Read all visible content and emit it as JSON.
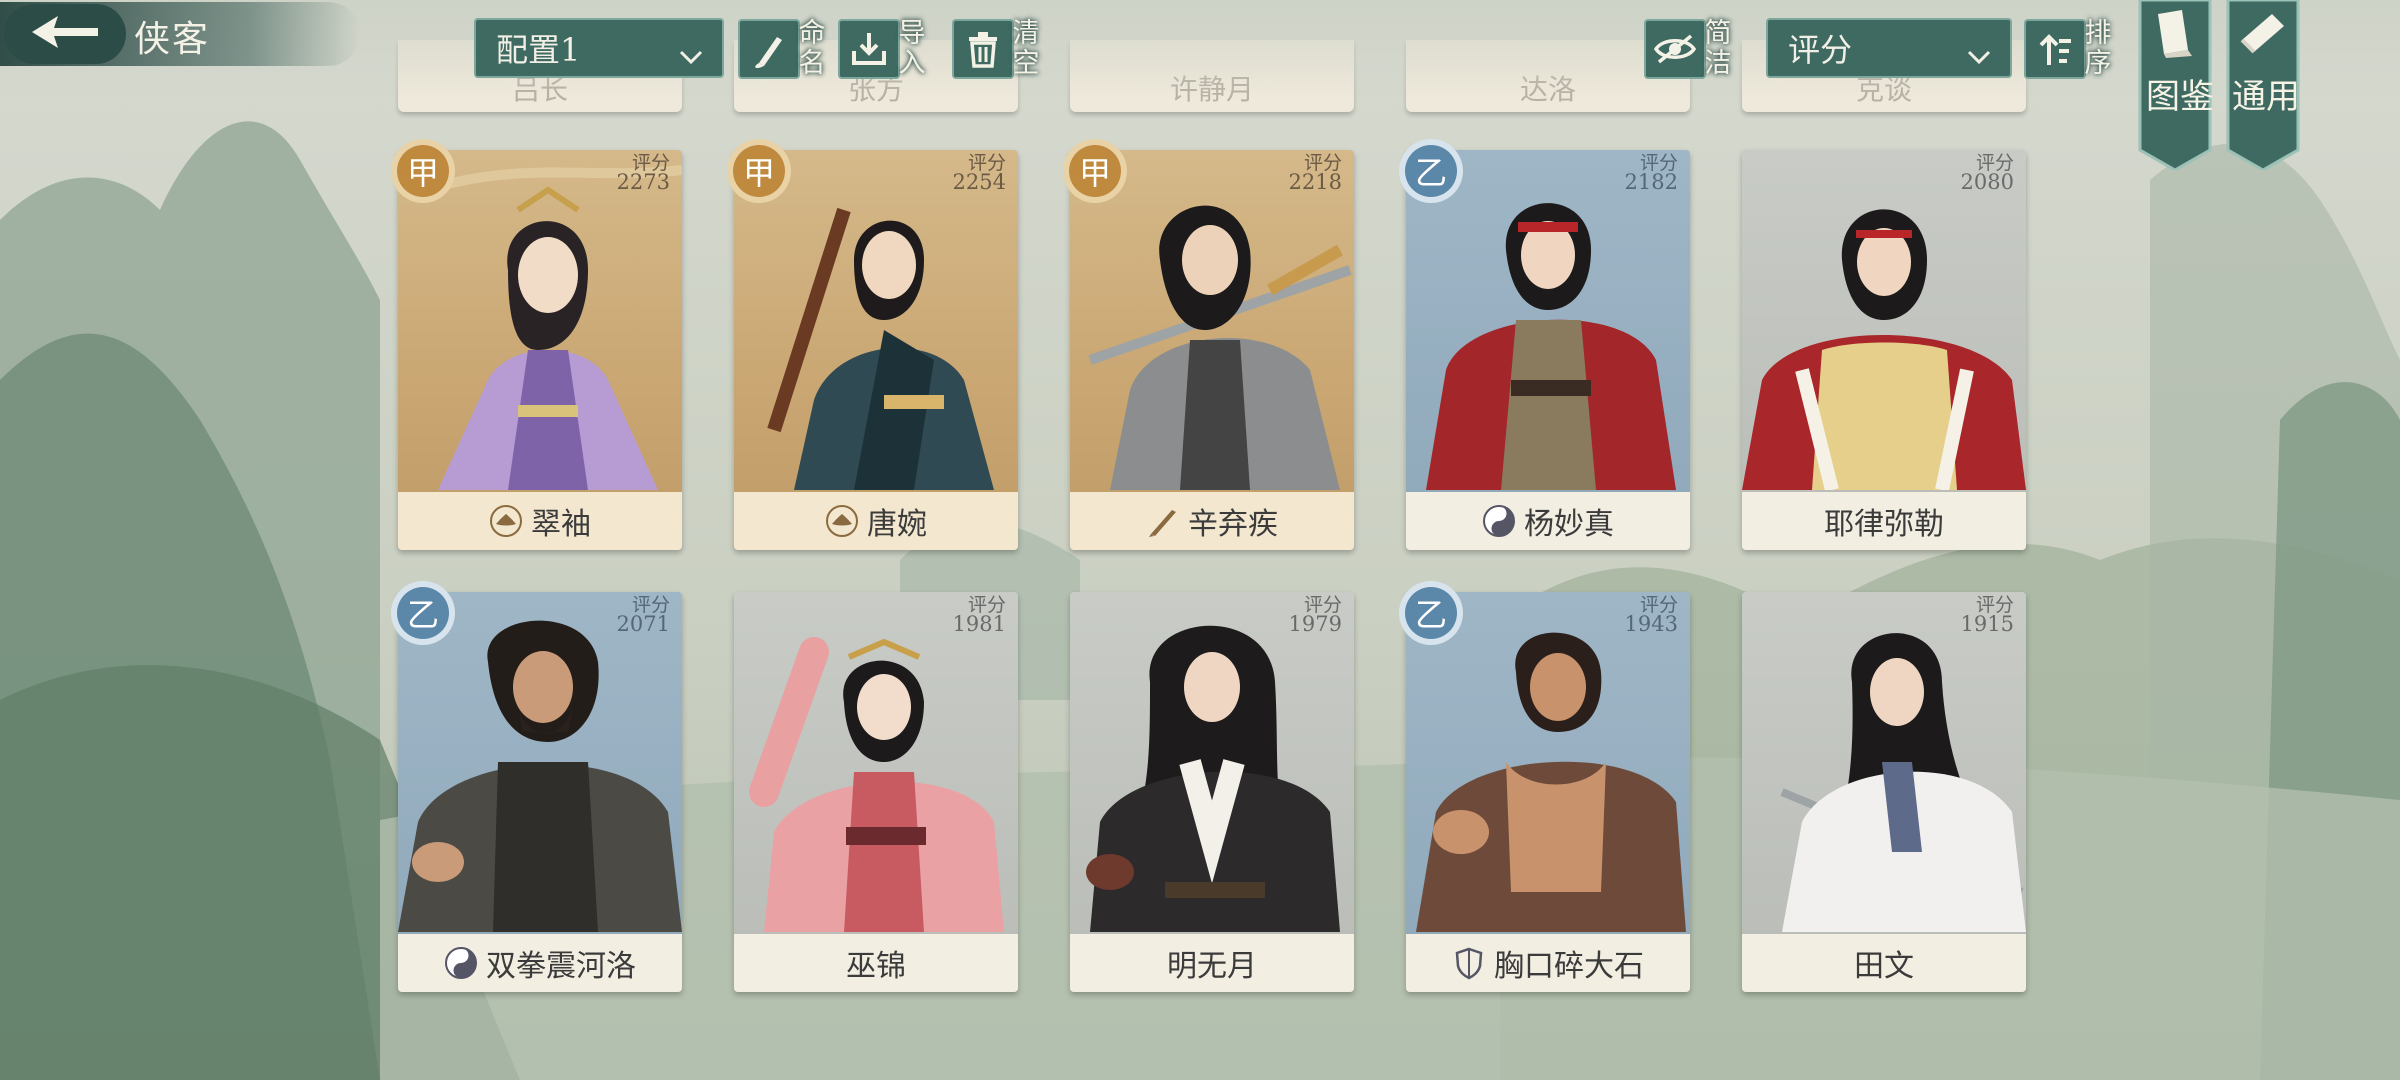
{
  "header": {
    "back_icon": "arrow-left-icon",
    "title": "侠客",
    "config_select": {
      "value": "配置1"
    },
    "rename_label": "命名",
    "import_label": "导入",
    "clear_label": "清空",
    "simplify_label": "简洁",
    "sort_select": {
      "value": "评分"
    },
    "sort_label": "排序",
    "codex_label": "图鉴",
    "general_label": "通用"
  },
  "score_label": "评分",
  "top_row_partial": [
    "吕长",
    "张方",
    "许静月",
    "达洛",
    "克谈"
  ],
  "cards": [
    {
      "name": "翠袖",
      "score": "2273",
      "tier": "甲",
      "tier_color": "#c08a3e",
      "faction_icon": "lotus-icon"
    },
    {
      "name": "唐婉",
      "score": "2254",
      "tier": "甲",
      "tier_color": "#c08a3e",
      "faction_icon": "lotus-icon"
    },
    {
      "name": "辛弃疾",
      "score": "2218",
      "tier": "甲",
      "tier_color": "#c08a3e",
      "faction_icon": "brush-icon"
    },
    {
      "name": "杨妙真",
      "score": "2182",
      "tier": "乙",
      "tier_color": "#5b87a8",
      "faction_icon": "taiji-icon"
    },
    {
      "name": "耶律弥勒",
      "score": "2080",
      "tier": "",
      "tier_color": "",
      "faction_icon": ""
    },
    {
      "name": "双拳震河洛",
      "score": "2071",
      "tier": "乙",
      "tier_color": "#5b87a8",
      "faction_icon": "taiji-icon"
    },
    {
      "name": "巫锦",
      "score": "1981",
      "tier": "",
      "tier_color": "",
      "faction_icon": ""
    },
    {
      "name": "明无月",
      "score": "1979",
      "tier": "",
      "tier_color": "",
      "faction_icon": ""
    },
    {
      "name": "胸口碎大石",
      "score": "1943",
      "tier": "乙",
      "tier_color": "#5b87a8",
      "faction_icon": "shield-icon"
    },
    {
      "name": "田文",
      "score": "1915",
      "tier": "",
      "tier_color": "",
      "faction_icon": ""
    }
  ],
  "colors": {
    "panel": "#3e6a62",
    "panel_border": "#7da79c",
    "gold_tier": "#c08a3e",
    "blue_tier": "#5b87a8"
  }
}
